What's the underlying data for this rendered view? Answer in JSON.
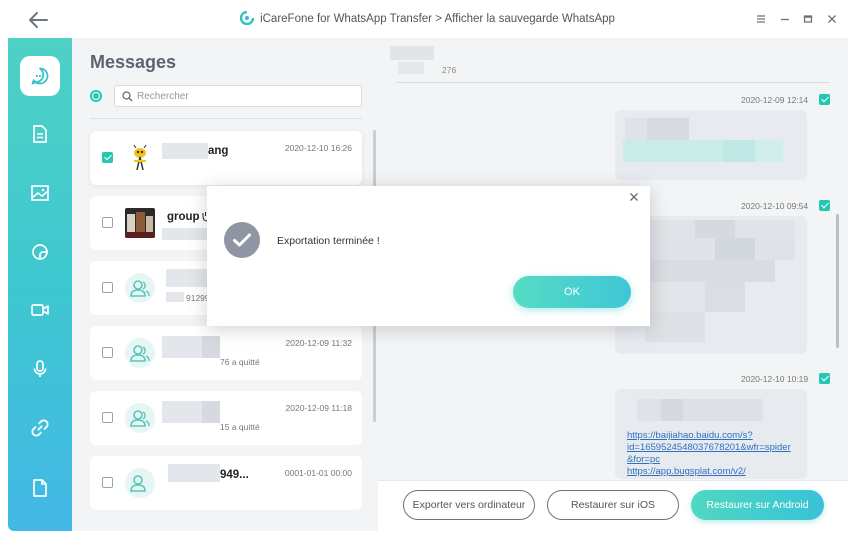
{
  "window": {
    "title": "iCareFone for WhatsApp Transfer > Afficher la sauvegarde WhatsApp"
  },
  "sidebar": {
    "items": [
      {
        "icon": "chat-bubble-icon",
        "active": true
      },
      {
        "icon": "document-icon"
      },
      {
        "icon": "image-icon"
      },
      {
        "icon": "sticker-icon"
      },
      {
        "icon": "video-icon"
      },
      {
        "icon": "microphone-icon"
      },
      {
        "icon": "link-icon"
      },
      {
        "icon": "file-icon"
      }
    ]
  },
  "messages_panel": {
    "title": "Messages",
    "search_placeholder": "Rechercher",
    "chats": [
      {
        "name": "ang",
        "subtitle": "",
        "time": "2020-12-10 16:26",
        "checked": true
      },
      {
        "name": "group",
        "subtitle": "",
        "time": "",
        "checked": false
      },
      {
        "name": "",
        "subtitle": "91299",
        "time": "",
        "checked": false
      },
      {
        "name": "",
        "subtitle": "76 a quitté",
        "time": "2020-12-09 11:32",
        "checked": false
      },
      {
        "name": "",
        "subtitle": "15 a quitté",
        "time": "2020-12-09 11:18",
        "checked": false
      },
      {
        "name": "949...",
        "subtitle": "",
        "time": "0001-01-01 00:00",
        "checked": false
      }
    ]
  },
  "conversation": {
    "header_number": "276",
    "messages": [
      {
        "time": "2020-12-09 12:14"
      },
      {
        "time": "2020-12-10 09:54"
      },
      {
        "time": "2020-12-10 10:19",
        "links": [
          "https://baijiahao.baidu.com/s?",
          "id=1659524548037678201&wfr=spider",
          "&for=pc",
          "https://app.bugsplat.com/v2/"
        ]
      }
    ]
  },
  "actions": {
    "export_label": "Exporter vers ordinateur",
    "restore_ios_label": "Restaurer sur iOS",
    "restore_android_label": "Restaurer sur Android"
  },
  "dialog": {
    "message": "Exportation terminée !",
    "ok_label": "OK"
  },
  "colors": {
    "accent": "#25c7b3",
    "sidebar_top": "#4fd1c5",
    "sidebar_bottom": "#43b8e6",
    "link": "#2f6fbf",
    "dialog_icon": "#8f95a3"
  }
}
